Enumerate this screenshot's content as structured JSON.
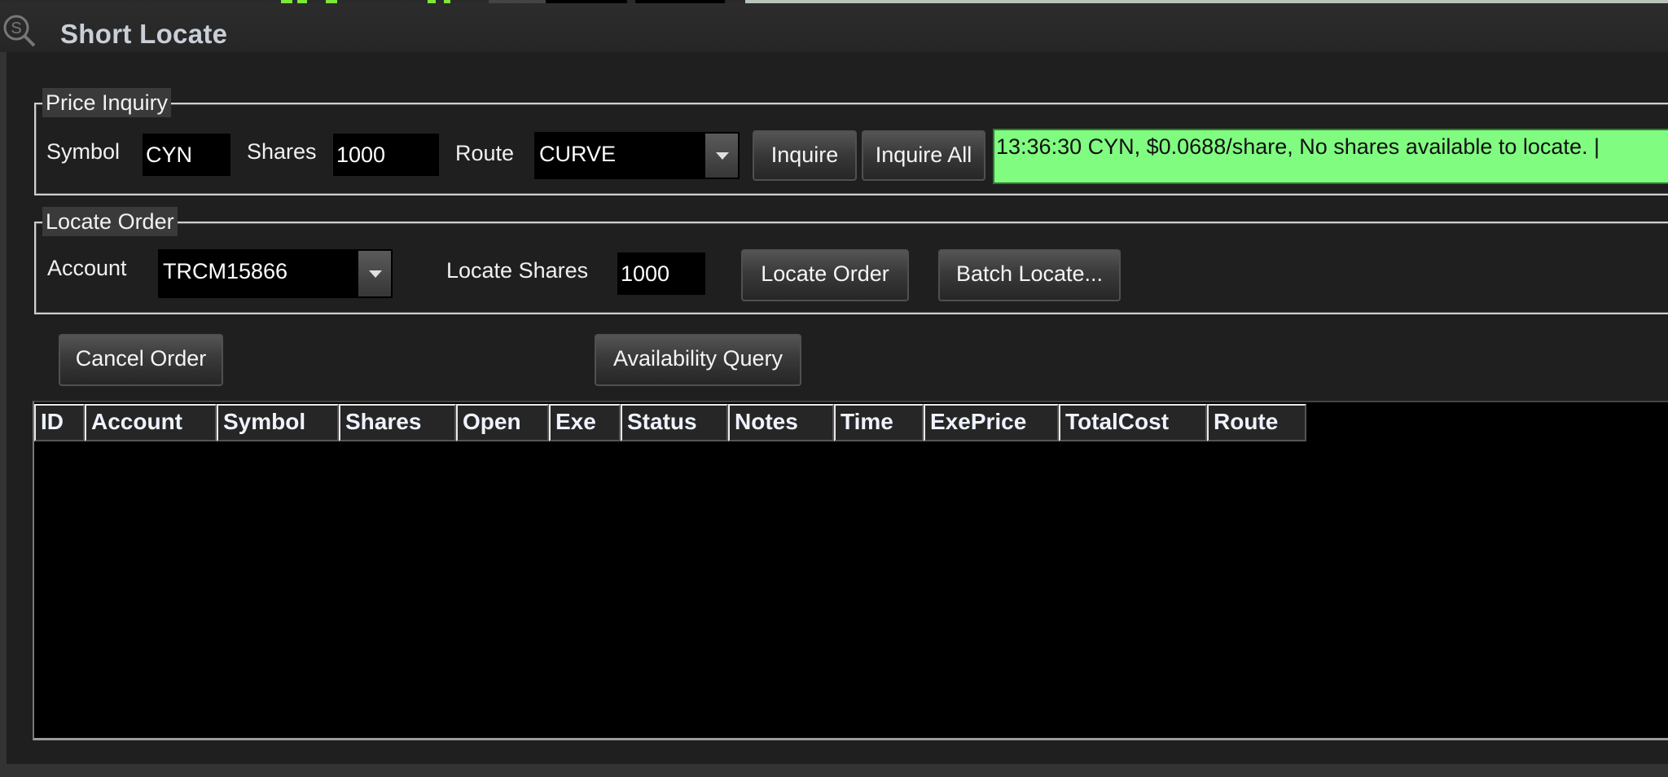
{
  "window": {
    "title": "Short Locate",
    "icon": "search-s-icon"
  },
  "price_inquiry": {
    "group_label": "Price Inquiry",
    "symbol_label": "Symbol",
    "symbol_value": "CYN",
    "shares_label": "Shares",
    "shares_value": "1000",
    "route_label": "Route",
    "route_value": "CURVE",
    "inquire_button": "Inquire",
    "inquire_all_button": "Inquire All",
    "status_message": "13:36:30 CYN, $0.0688/share, No shares available to locate. |",
    "status_color": "#80fc80"
  },
  "locate_order": {
    "group_label": "Locate Order",
    "account_label": "Account",
    "account_value": "TRCM15866",
    "locate_shares_label": "Locate Shares",
    "locate_shares_value": "1000",
    "locate_order_button": "Locate Order",
    "batch_locate_button": "Batch Locate..."
  },
  "actions": {
    "cancel_order_button": "Cancel Order",
    "availability_query_button": "Availability Query"
  },
  "orders_table": {
    "columns": [
      "ID",
      "Account",
      "Symbol",
      "Shares",
      "Open",
      "Exe",
      "Status",
      "Notes",
      "Time",
      "ExePrice",
      "TotalCost",
      "Route"
    ],
    "rows": []
  }
}
